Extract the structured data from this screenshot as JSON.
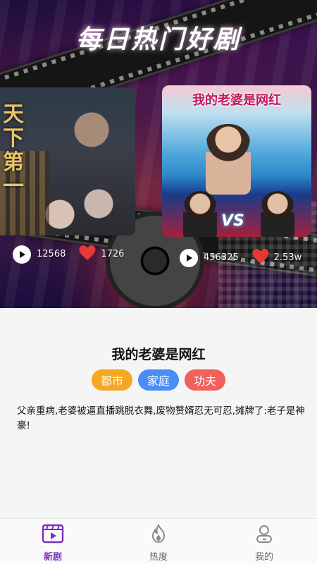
{
  "hero": {
    "title": "每日热门好剧",
    "posters": [
      {
        "cover_text": "天下第一",
        "play_count": "12568",
        "like_count": "1726"
      },
      {
        "cover_text": "我的老婆是网红",
        "vs_text": "VS",
        "play_count": "456325",
        "like_count": "2.53w"
      }
    ]
  },
  "drama": {
    "title": "我的老婆是网红",
    "tags": [
      "都市",
      "家庭",
      "功夫"
    ],
    "description": "父亲重病,老婆被逼直播跳脱衣舞,废物赘婿忍无可忍,摊牌了:老子是神豪!"
  },
  "tabbar": {
    "tabs": [
      {
        "label": "新剧",
        "icon": "film-icon",
        "active": true
      },
      {
        "label": "热度",
        "icon": "flame-icon",
        "active": false
      },
      {
        "label": "我的",
        "icon": "user-icon",
        "active": false
      }
    ]
  },
  "colors": {
    "accent": "#7b2fbe",
    "tag_colors": [
      "#f5a623",
      "#4a8df6",
      "#f2605a"
    ],
    "heart": "#e53935"
  }
}
